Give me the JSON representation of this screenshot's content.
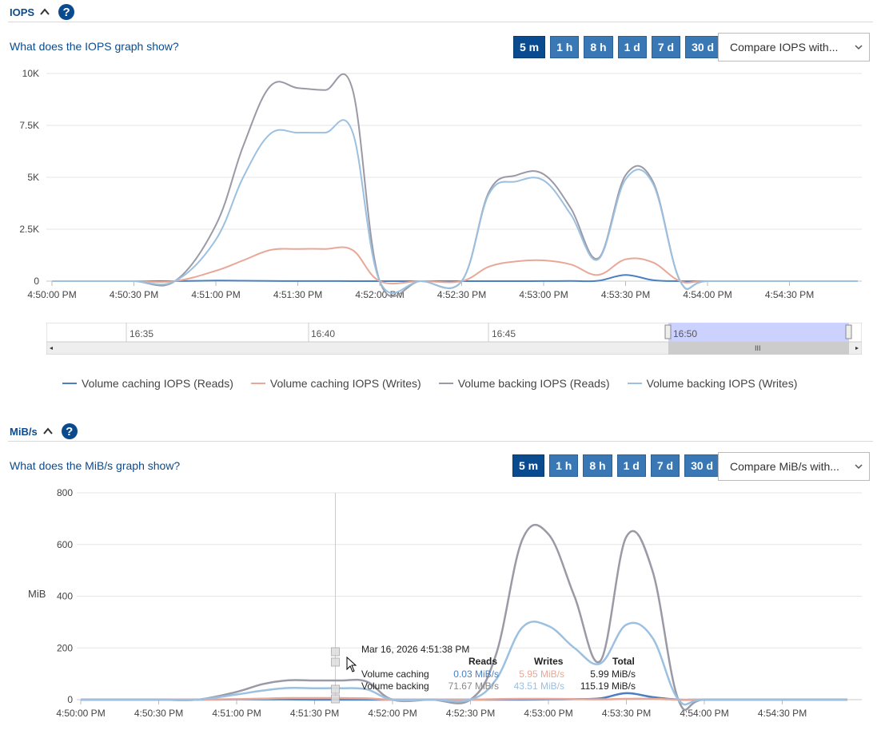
{
  "iops": {
    "title": "IOPS",
    "help_glyph": "?",
    "what_link": "What does the IOPS graph show?",
    "ranges": [
      "5 m",
      "1 h",
      "8 h",
      "1 d",
      "7 d",
      "30 d"
    ],
    "active_range": "5 m",
    "compare_label": "Compare IOPS with...",
    "navigator_ticks": [
      "16:35",
      "16:40",
      "16:45",
      "16:50"
    ],
    "legend": [
      {
        "name": "Volume caching IOPS (Reads)",
        "color": "#4a7fc1"
      },
      {
        "name": "Volume caching IOPS (Writes)",
        "color": "#e8a898"
      },
      {
        "name": "Volume backing IOPS (Reads)",
        "color": "#9a9aa6"
      },
      {
        "name": "Volume backing IOPS (Writes)",
        "color": "#9cc0e0"
      }
    ]
  },
  "mibs": {
    "title": "MiB/s",
    "help_glyph": "?",
    "what_link": "What does the MiB/s graph show?",
    "ranges": [
      "5 m",
      "1 h",
      "8 h",
      "1 d",
      "7 d",
      "30 d"
    ],
    "active_range": "5 m",
    "compare_label": "Compare MiB/s with...",
    "tooltip": {
      "date": "Mar 16, 2026 4:51:38 PM",
      "headers": [
        "Reads",
        "Writes",
        "Total"
      ],
      "rows": [
        {
          "label": "Volume caching",
          "reads": "0.03 MiB/s",
          "writes": "5.95 MiB/s",
          "total": "5.99 MiB/s"
        },
        {
          "label": "Volume backing",
          "reads": "71.67 MiB/s",
          "writes": "43.51 MiB/s",
          "total": "115.19 MiB/s"
        }
      ]
    }
  },
  "chart_data": [
    {
      "type": "line",
      "title": "IOPS",
      "xlabel": "",
      "ylabel": "",
      "x": [
        "4:50:00 PM",
        "4:50:15 PM",
        "4:50:30 PM",
        "4:50:45 PM",
        "4:51:00 PM",
        "4:51:10 PM",
        "4:51:20 PM",
        "4:51:30 PM",
        "4:51:40 PM",
        "4:51:50 PM",
        "4:52:00 PM",
        "4:52:15 PM",
        "4:52:30 PM",
        "4:52:40 PM",
        "4:52:50 PM",
        "4:53:00 PM",
        "4:53:10 PM",
        "4:53:20 PM",
        "4:53:30 PM",
        "4:53:40 PM",
        "4:53:50 PM",
        "4:54:00 PM",
        "4:54:30 PM",
        "4:54:55 PM"
      ],
      "x_ticks": [
        "4:50:00 PM",
        "4:50:30 PM",
        "4:51:00 PM",
        "4:51:30 PM",
        "4:52:00 PM",
        "4:52:30 PM",
        "4:53:00 PM",
        "4:53:30 PM",
        "4:54:00 PM",
        "4:54:30 PM"
      ],
      "y_ticks": [
        "0",
        "2.5K",
        "5K",
        "7.5K",
        "10K"
      ],
      "ylim": [
        0,
        10000
      ],
      "grid": true,
      "legend_position": "bottom",
      "series": [
        {
          "name": "Volume caching IOPS (Reads)",
          "color": "#4a7fc1",
          "values": [
            0,
            0,
            0,
            0,
            30,
            20,
            10,
            5,
            5,
            0,
            0,
            0,
            0,
            0,
            0,
            5,
            10,
            20,
            300,
            50,
            0,
            0,
            0,
            0
          ]
        },
        {
          "name": "Volume caching IOPS (Writes)",
          "color": "#e8a898",
          "values": [
            0,
            0,
            0,
            0,
            500,
            1000,
            1500,
            1550,
            1550,
            1500,
            0,
            0,
            0,
            700,
            950,
            1000,
            800,
            300,
            1050,
            900,
            0,
            0,
            0,
            0
          ]
        },
        {
          "name": "Volume backing IOPS (Reads)",
          "color": "#9a9aa6",
          "values": [
            0,
            0,
            0,
            0,
            2700,
            6500,
            9400,
            9300,
            9200,
            9250,
            0,
            0,
            0,
            4300,
            5100,
            5150,
            3500,
            1100,
            5100,
            4800,
            0,
            0,
            0,
            0
          ]
        },
        {
          "name": "Volume backing IOPS (Writes)",
          "color": "#9cc0e0",
          "values": [
            0,
            0,
            0,
            0,
            2000,
            5000,
            7100,
            7150,
            7150,
            7200,
            0,
            0,
            0,
            4200,
            4800,
            4850,
            3200,
            1050,
            4900,
            4700,
            0,
            0,
            0,
            0
          ]
        }
      ]
    },
    {
      "type": "line",
      "title": "MiB/s",
      "xlabel": "",
      "ylabel": "MiB",
      "x": [
        "4:50:00 PM",
        "4:50:15 PM",
        "4:50:30 PM",
        "4:50:45 PM",
        "4:51:00 PM",
        "4:51:10 PM",
        "4:51:20 PM",
        "4:51:30 PM",
        "4:51:40 PM",
        "4:51:50 PM",
        "4:52:00 PM",
        "4:52:15 PM",
        "4:52:30 PM",
        "4:52:40 PM",
        "4:52:50 PM",
        "4:53:00 PM",
        "4:53:10 PM",
        "4:53:20 PM",
        "4:53:30 PM",
        "4:53:40 PM",
        "4:53:50 PM",
        "4:54:00 PM",
        "4:54:30 PM",
        "4:54:55 PM"
      ],
      "x_ticks": [
        "4:50:00 PM",
        "4:50:30 PM",
        "4:51:00 PM",
        "4:51:30 PM",
        "4:52:00 PM",
        "4:52:30 PM",
        "4:53:00 PM",
        "4:53:30 PM",
        "4:54:00 PM",
        "4:54:30 PM"
      ],
      "y_ticks": [
        "0",
        "200",
        "400",
        "600",
        "800"
      ],
      "ylim": [
        0,
        800
      ],
      "grid": true,
      "series": [
        {
          "name": "Volume caching Reads",
          "color": "#4a7fc1",
          "values": [
            0,
            0,
            0,
            0,
            1,
            1,
            1,
            0.03,
            0.03,
            0,
            0,
            0,
            0,
            0,
            0,
            1,
            2,
            5,
            25,
            10,
            0,
            0,
            0,
            0
          ]
        },
        {
          "name": "Volume caching Writes",
          "color": "#e8a898",
          "values": [
            0,
            0,
            0,
            0,
            2,
            4,
            6,
            6,
            6,
            5,
            0,
            0,
            0,
            2,
            3,
            3,
            2,
            1,
            3,
            3,
            0,
            0,
            0,
            0
          ]
        },
        {
          "name": "Volume backing Reads",
          "color": "#9a9aa6",
          "values": [
            0,
            0,
            0,
            0,
            30,
            60,
            75,
            74,
            74,
            70,
            0,
            0,
            0,
            180,
            620,
            640,
            400,
            150,
            630,
            500,
            0,
            0,
            0,
            0
          ]
        },
        {
          "name": "Volume backing Writes",
          "color": "#9cc0e0",
          "values": [
            0,
            0,
            0,
            0,
            20,
            35,
            45,
            44,
            44,
            40,
            0,
            0,
            0,
            80,
            280,
            285,
            200,
            140,
            290,
            240,
            0,
            0,
            0,
            0
          ]
        }
      ]
    }
  ]
}
